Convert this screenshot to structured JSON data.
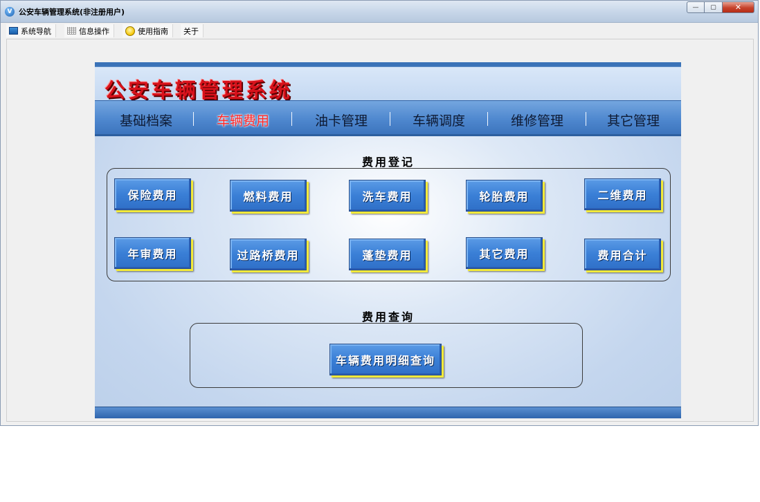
{
  "window": {
    "title": "公安车辆管理系统(非注册用户)",
    "icon": "app-logo-icon",
    "controls": {
      "minimize": "—",
      "maximize": "▢",
      "close": "✕"
    }
  },
  "menubar": {
    "items": [
      {
        "label": "系统导航",
        "icon": "nav-window-icon"
      },
      {
        "label": "信息操作",
        "icon": "grid-icon"
      },
      {
        "label": "使用指南",
        "icon": "help-circle-icon"
      },
      {
        "label": "关于",
        "icon": ""
      }
    ]
  },
  "header": {
    "brand_title": "公安车辆管理系统"
  },
  "nav": {
    "items": [
      "基础档案",
      "车辆费用",
      "油卡管理",
      "车辆调度",
      "维修管理",
      "其它管理"
    ],
    "active": "车辆费用",
    "separator": "|"
  },
  "fee_register": {
    "label": "费用登记",
    "buttons": [
      "保险费用",
      "燃料费用",
      "洗车费用",
      "轮胎费用",
      "二维费用",
      "年审费用",
      "过路桥费用",
      "蓬垫费用",
      "其它费用",
      "费用合计"
    ]
  },
  "fee_query": {
    "label": "费用查询",
    "button": "车辆费用明细查询"
  },
  "colors": {
    "accent_blue": "#3a7fd6",
    "active_nav": "#ff2626",
    "brand_red": "#d8121b",
    "button_shadow_yellow": "#f3ea3a"
  }
}
